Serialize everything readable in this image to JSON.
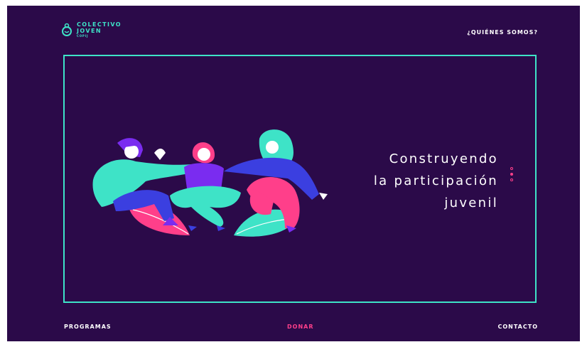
{
  "brand": {
    "line1": "COLECTIVO",
    "line2": "JOVEN",
    "line3": "COPIJ"
  },
  "header": {
    "nav_about": "¿QUIÉNES SOMOS?"
  },
  "hero": {
    "headline_line1": "Construyendo",
    "headline_line2": "la participación",
    "headline_line3": "juvenil",
    "slides": 3,
    "active_slide": 2
  },
  "footer": {
    "programas": "PROGRAMAS",
    "donar": "DONAR",
    "contacto": "CONTACTO"
  },
  "colors": {
    "background": "#2b0a49",
    "accent_teal": "#3ee3c7",
    "accent_pink": "#ff3f8a",
    "purple": "#7a2cf0",
    "blue": "#3b3fe0"
  }
}
